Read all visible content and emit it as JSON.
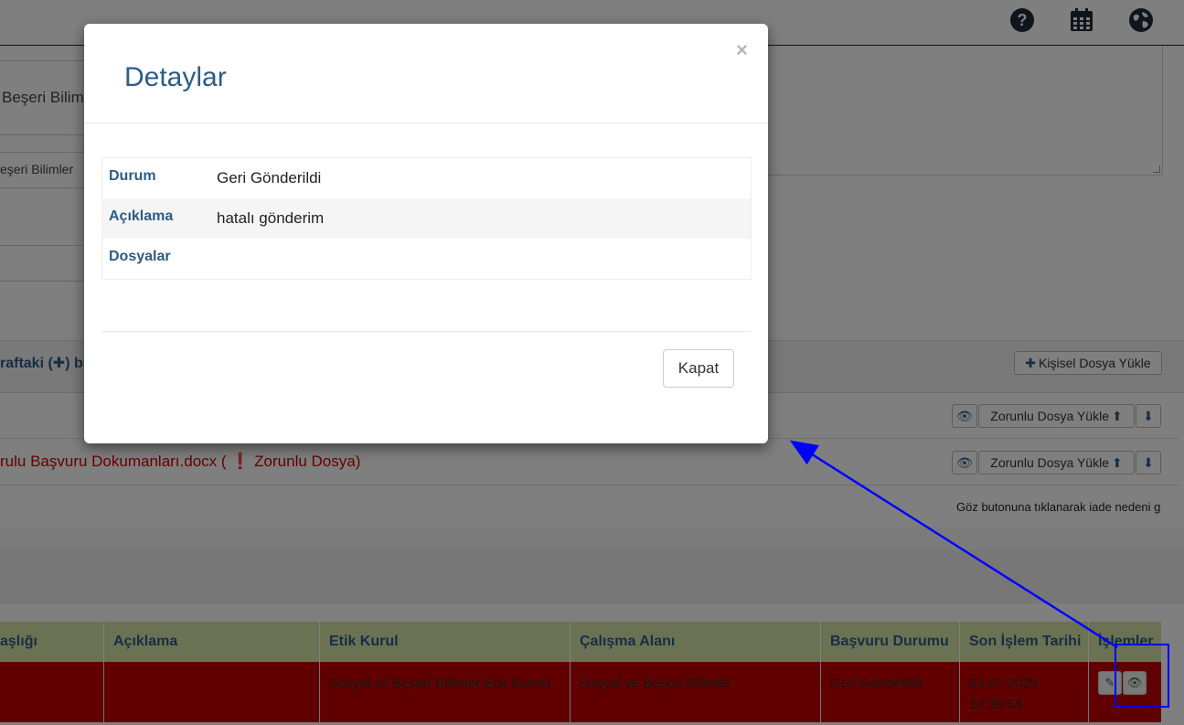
{
  "background": {
    "field_text_1": "Beşeri Bilim",
    "field_text_2": "eşeri Bilimler",
    "panel_heading": "raftaki (✚) bu",
    "personal_upload_label": "Kişisel Dosya Yükle",
    "required_upload_label": "Zorunlu Dosya Yükle",
    "row2_text": "rulu Başvuru Dokumanları.docx ( ❗ Zorunlu Dosya)",
    "note": "Göz butonuna tıklanarak iade nedeni g"
  },
  "table": {
    "headers": [
      "aşlığı",
      "Açıklama",
      "Etik Kurul",
      "Çalışma Alanı",
      "Başvuru Durumu",
      "Son İşlem Tarihi",
      "İşlemler"
    ],
    "row": {
      "title": "",
      "description": "",
      "ethics_board": "Sosyal ve Beşeri Bilimler Etik Kurulu",
      "field": "Sosyal ve Beşeri Bilimler",
      "status": "Geri Gönderildi",
      "date": "01.07.2025 10:39:54"
    }
  },
  "modal": {
    "title": "Detaylar",
    "close_symbol": "×",
    "rows": [
      {
        "label": "Durum",
        "value": "Geri Gönderildi"
      },
      {
        "label": "Açıklama",
        "value": "hatalı gönderim"
      },
      {
        "label": "Dosyalar",
        "value": ""
      }
    ],
    "close_button": "Kapat"
  },
  "icons": {
    "help": "question-circle-icon",
    "calendar": "calendar-icon",
    "language": "globe-icon",
    "view": "eye-icon",
    "edit": "pencil-icon",
    "upload": "upload-icon",
    "download": "download-icon"
  },
  "colors": {
    "accent_blue": "#2d5c88",
    "row_red": "#c00000",
    "header_green": "#d6e4a8",
    "annotation_blue": "#0000ff"
  }
}
